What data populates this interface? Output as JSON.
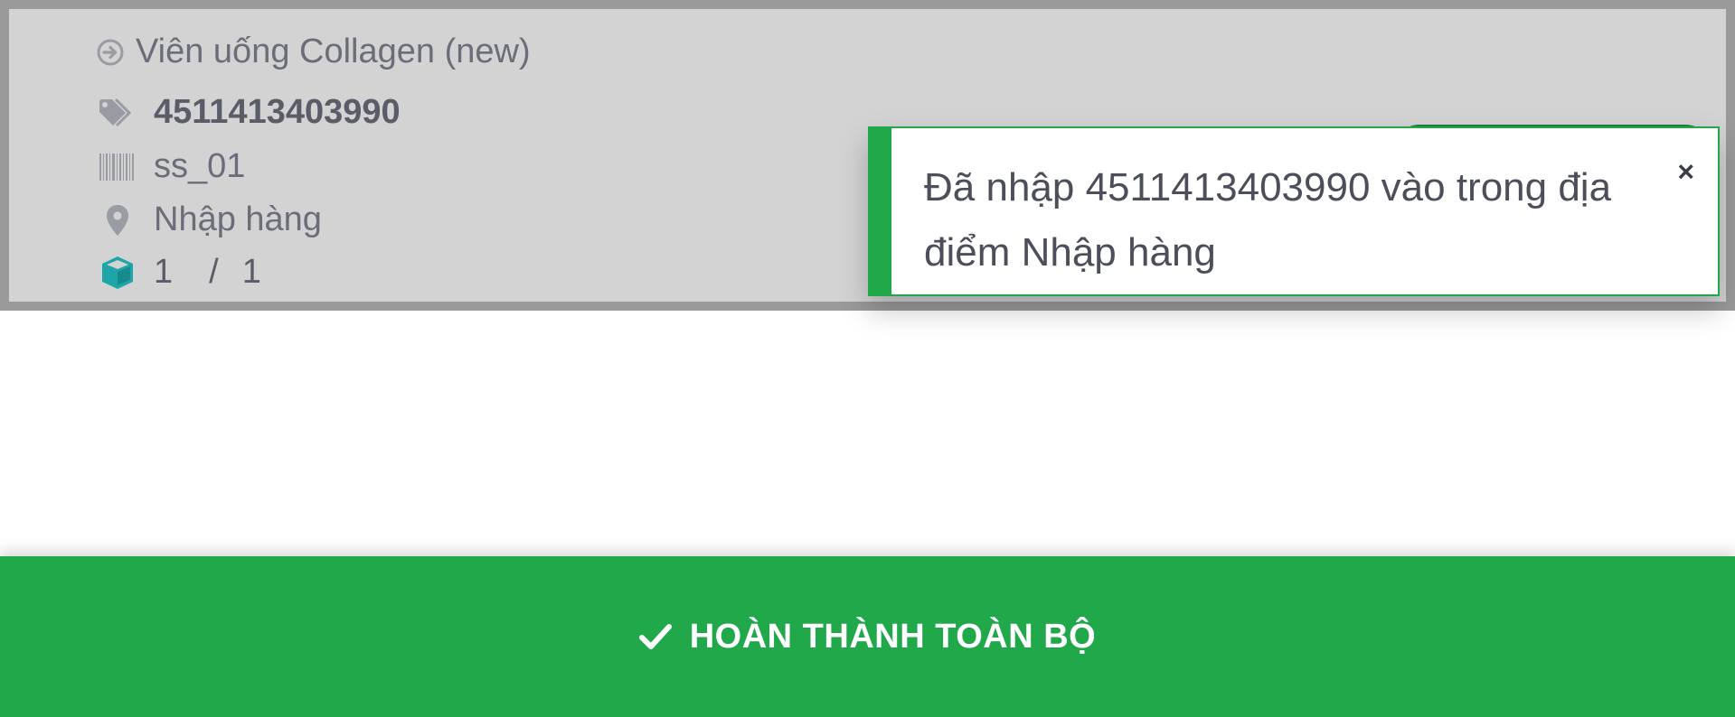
{
  "product": {
    "name": "Viên uống Collagen (new)",
    "lot_number": "4511413403990",
    "barcode": "ss_01",
    "location": "Nhập hàng",
    "qty_done": "1",
    "qty_separator": "/",
    "qty_total": "1"
  },
  "toast": {
    "message": "Đã nhập 4511413403990 vào trong địa điểm Nhập hàng",
    "close_label": "×",
    "accent_color": "#21a84a"
  },
  "bottom_bar": {
    "label": "HOÀN THÀNH TOÀN BỘ",
    "color": "#21a84a"
  },
  "icons": {
    "product": "arrow-circle-right-icon",
    "lot": "tags-icon",
    "barcode": "barcode-icon",
    "location": "map-marker-icon",
    "quantity": "cube-icon",
    "confirm": "check-icon"
  }
}
